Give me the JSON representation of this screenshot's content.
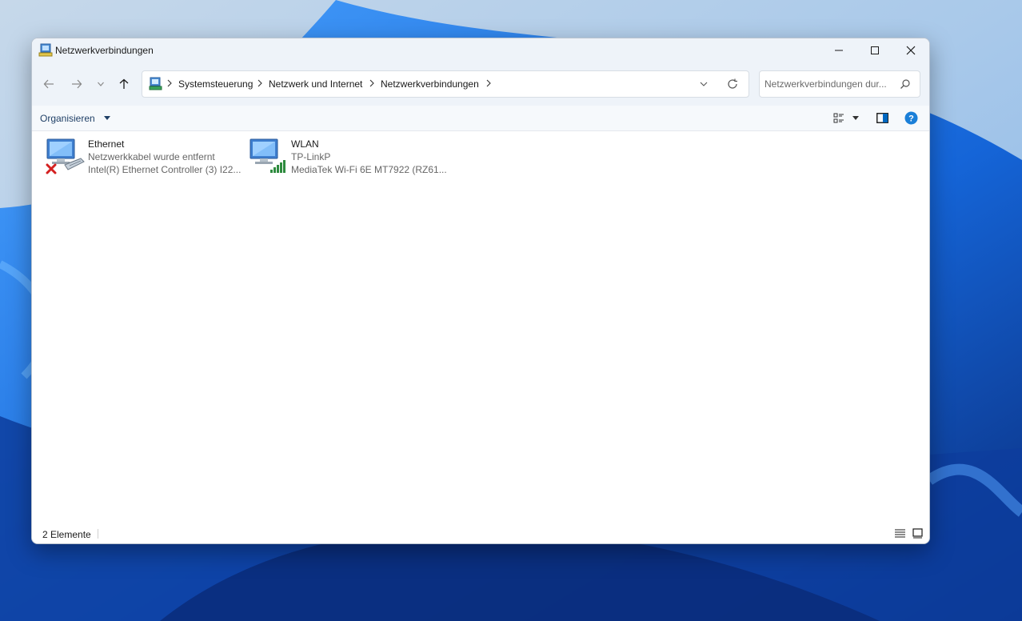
{
  "window": {
    "title": "Netzwerkverbindungen"
  },
  "address": {
    "breadcrumbs": [
      "Systemsteuerung",
      "Netzwerk und Internet",
      "Netzwerkverbindungen"
    ]
  },
  "search": {
    "placeholder": "Netzwerkverbindungen dur..."
  },
  "toolbar": {
    "organize_label": "Organisieren"
  },
  "connections": [
    {
      "name": "Ethernet",
      "status": "Netzwerkkabel wurde entfernt",
      "device": "Intel(R) Ethernet Controller (3) I22...",
      "icon": "ethernet-disconnected-icon"
    },
    {
      "name": "WLAN",
      "status": "TP-LinkP",
      "device": "MediaTek Wi-Fi 6E MT7922 (RZ61...",
      "icon": "wifi-connected-icon"
    }
  ],
  "statusbar": {
    "count": "2 Elemente"
  },
  "colors": {
    "accent": "#0067c0",
    "titlebar": "#eef3f9",
    "wallpaper": "#2f7be0"
  }
}
